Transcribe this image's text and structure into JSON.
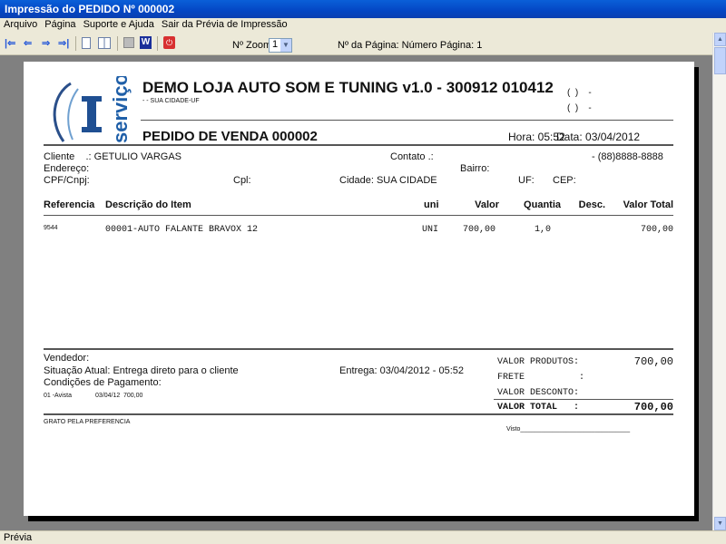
{
  "window": {
    "title": "Impressão do PEDIDO Nº 000002"
  },
  "menu": [
    "Arquivo",
    "Página",
    "Suporte e Ajuda",
    "Sair da Prévia de Impressão"
  ],
  "toolbar": {
    "zoom_label": "Nº Zoom",
    "zoom_value": "1",
    "page_label": "Nº da Página: Número Página: 1"
  },
  "status": "Prévia",
  "report": {
    "logo_text": "serviço",
    "company": "DEMO LOJA AUTO SOM E TUNING v1.0 - 300912 010412",
    "address": "- - SUA CIDADE-UF",
    "phone1": "(  )    -",
    "phone2": "(  )    -",
    "title": "PEDIDO DE VENDA 000002",
    "hora": "Hora: 05:52",
    "data": "Data: 03/04/2012",
    "cliente": "Cliente    .: GETULIO VARGAS",
    "contato": "Contato .:",
    "telefone": "- (88)8888-8888",
    "endereco": "Endereço:",
    "bairro": "Bairro:",
    "cpf": "CPF/Cnpj:",
    "cpl": "Cpl:",
    "cidade": "Cidade: SUA CIDADE",
    "uf": "UF:",
    "cep": "CEP:",
    "columns": [
      "Referencia",
      "Descrição do Item",
      "uni",
      "Valor",
      "Quantia",
      "Desc.",
      "Valor Total"
    ],
    "items": [
      {
        "ref": "9544",
        "desc": "00001-AUTO FALANTE BRAVOX 12",
        "uni": "UNI",
        "valor": "700,00",
        "qtd": "1,0",
        "desc_val": "",
        "total": "700,00"
      }
    ],
    "vendedor": "Vendedor:",
    "situacao": "Situação Atual: Entrega direto para o cliente",
    "entrega": "Entrega: 03/04/2012 - 05:52",
    "condicoes": "Condições de Pagamento:",
    "parcela": {
      "tipo": "01 -Avista",
      "data": "03/04/12",
      "valor": "700,00"
    },
    "totais": [
      {
        "label": "VALOR PRODUTOS:",
        "value": "700,00"
      },
      {
        "label": "FRETE          :",
        "value": ""
      },
      {
        "label": "VALOR DESCONTO:",
        "value": ""
      },
      {
        "label": "VALOR TOTAL   :",
        "value": "700,00"
      }
    ],
    "grato": "GRATO PELA PREFERENCIA",
    "visto": "Visto_______________________________"
  }
}
